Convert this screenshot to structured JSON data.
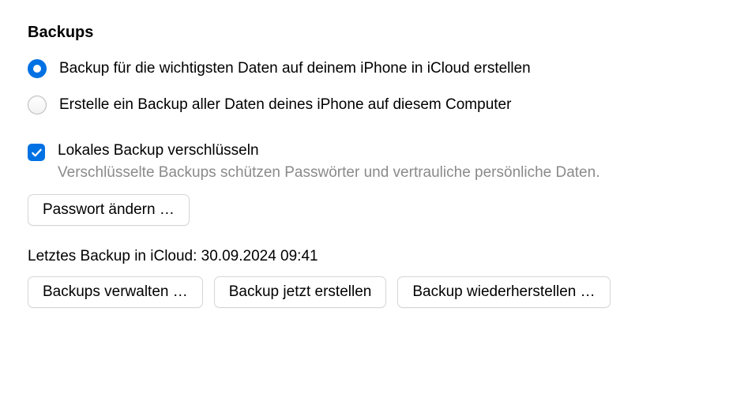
{
  "title": "Backups",
  "radio_icloud": {
    "label": "Backup für die wichtigsten Daten auf deinem iPhone in iCloud erstellen",
    "selected": true
  },
  "radio_local": {
    "label": "Erstelle ein Backup aller Daten deines iPhone auf diesem Computer",
    "selected": false
  },
  "encrypt": {
    "label": "Lokales Backup verschlüsseln",
    "sub": "Verschlüsselte Backups schützen Passwörter und vertrauliche persönliche Daten.",
    "checked": true
  },
  "buttons": {
    "change_password": "Passwort ändern …",
    "manage_backups": "Backups verwalten …",
    "backup_now": "Backup jetzt erstellen",
    "restore_backup": "Backup wiederherstellen …"
  },
  "last_backup": "Letztes Backup in iCloud: 30.09.2024 09:41"
}
